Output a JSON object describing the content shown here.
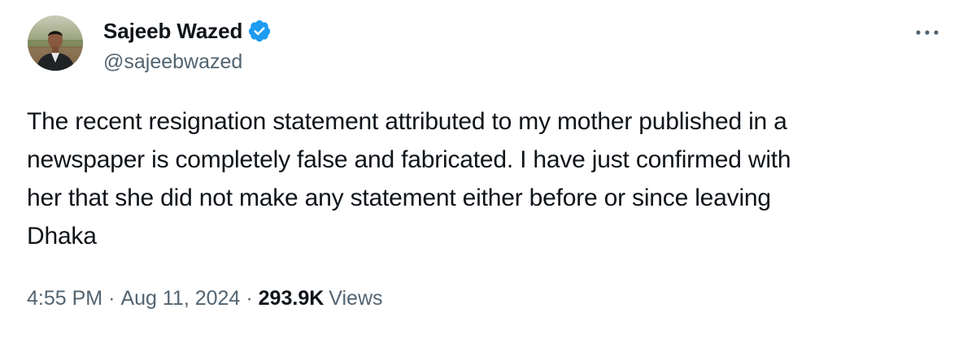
{
  "author": {
    "name": "Sajeeb Wazed",
    "handle": "@sajeebwazed",
    "verified": true
  },
  "icons": {
    "verified": "verified-badge-icon",
    "more": "more-options-icon",
    "avatar": "profile-photo"
  },
  "colors": {
    "text": "#0f1419",
    "secondary": "#536471",
    "verified_blue": "#1d9bf0"
  },
  "tweet": {
    "text": "The recent resignation statement attributed to my mother published in a\nnewspaper is completely false and fabricated. I have just confirmed with\nher that she did not make any statement either before or since leaving\nDhaka"
  },
  "meta": {
    "time": "4:55 PM",
    "separator": "·",
    "date": "Aug 11, 2024",
    "views_count": "293.9K",
    "views_label": "Views"
  }
}
